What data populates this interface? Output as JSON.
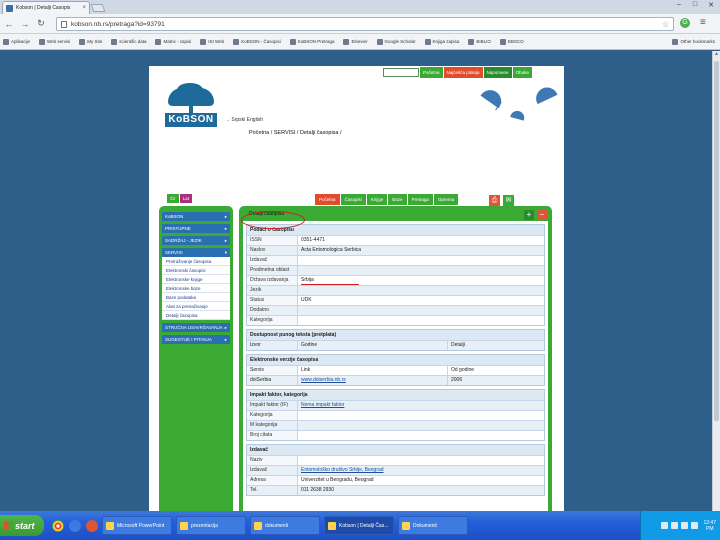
{
  "browser": {
    "tab_title": "Kobson | Detalji Časopis",
    "url": "kobson.nb.rs/pretraga?id=93791",
    "extension_badge": "G"
  },
  "bookmarks": [
    "Aplikacije",
    "Web servisi",
    "My Site",
    "scientific data",
    "Matrix - zapisi",
    "ISI Web",
    "KoBSON - Časopisi",
    "KoBSON Pretraga",
    "Elsevier",
    "Google Scholar",
    "Knjiga zapisa",
    "BIBLIO",
    "EBSCO",
    "Other bookmarks"
  ],
  "page": {
    "top_nav": [
      "Početna",
      "Najčešća pitanja",
      "Napomene",
      "Obuke"
    ],
    "logo_text": "KoBSON",
    "lang_switch": "→ Srpski  English",
    "breadcrumb": "Početna / SERVISI / Detalji časopisa /",
    "section_tabs": [
      "Početna",
      "Časopisi",
      "Knjige",
      "Baze",
      "Pretraga",
      "Oprema"
    ],
    "lang_tabs": [
      "Ćir",
      "Lat"
    ],
    "sidebar": {
      "items": [
        {
          "label": "KoBSON",
          "arrow": "▸"
        },
        {
          "label": "PRISTUPNE",
          "arrow": "▸"
        },
        {
          "label": "SADRŽAJ - JEZIK",
          "arrow": "▸"
        },
        {
          "label": "SERVISI",
          "arrow": "▾"
        }
      ],
      "submenu": [
        "Pretraživanje časopisa",
        "Elektronski časopisi",
        "Elektronske knjige",
        "Elektronske baze",
        "Baze podataka",
        "Alati za pretraživanje",
        "Detalji časopisa"
      ],
      "items_after": [
        {
          "label": "STRUČNA USAVRŠAVANJA",
          "arrow": "▸"
        },
        {
          "label": "SUGESTIJE I PITANJA",
          "arrow": "▸"
        }
      ]
    },
    "main": {
      "title": "Detalji časopisa",
      "sections": {
        "basic": {
          "title": "Podaci o časopisu",
          "rows": [
            {
              "label": "ISSN",
              "value": "0351-4471"
            },
            {
              "label": "Naslov",
              "value": "Acta Entomologica Serbica"
            },
            {
              "label": "Izdavač",
              "value": ""
            },
            {
              "label": "Predmetna oblast",
              "value": ""
            },
            {
              "label": "Država izdavanja",
              "value": "Srbija"
            },
            {
              "label": "Jezik",
              "value": ""
            },
            {
              "label": "Status",
              "value": "UDK"
            },
            {
              "label": "Dodatno",
              "value": ""
            },
            {
              "label": "Kategorija",
              "value": ""
            }
          ]
        },
        "fulltext": {
          "title": "Dostupnost punog teksta (pretplata)",
          "header": [
            "Izvor",
            "Godine",
            "Detalji"
          ],
          "rows": [
            [
              "Izvor",
              "Godine",
              "Detalji"
            ]
          ]
        },
        "links": {
          "title": "Elektronske verzije časopisa",
          "header": [
            "Servis",
            "Link",
            "Od godine"
          ],
          "rows": [
            [
              "doiSerbia",
              "www.doiserbia.nb.rs",
              "2006"
            ]
          ]
        },
        "impact": {
          "title": "Impakt faktor, kategorija",
          "rows": [
            {
              "label": "Impakt faktor (IF)",
              "value": "Nema impakt faktor",
              "link": true
            },
            {
              "label": "Kategorija",
              "value": ""
            },
            {
              "label": "M kategorija",
              "value": ""
            },
            {
              "label": "Broj citata",
              "value": ""
            }
          ]
        },
        "publisher": {
          "title": "Izdavač",
          "rows": [
            {
              "label": "Naziv",
              "value": ""
            },
            {
              "label": "Izdavač",
              "value": "Entomološko društvo Srbije, Beograd",
              "link": true
            },
            {
              "label": "Adresa",
              "value": "Univerzitet u Beogradu, Beograd"
            },
            {
              "label": "Tel.",
              "value": "011 2638 2930"
            }
          ]
        }
      }
    }
  },
  "taskbar": {
    "start_label": "start",
    "tasks": [
      "Microsoft PowerPoint",
      "prezentacija",
      "dokumenti",
      "Kobson | Detalji Čas...",
      "Dokumenti"
    ],
    "clock_time": "12:47",
    "clock_label": "PM"
  },
  "colors": {
    "accent_green": "#3aaa35",
    "accent_red": "#e24b2b",
    "page_background": "#2e5f8b",
    "sidebar_item_blue": "#2a6fb0"
  }
}
